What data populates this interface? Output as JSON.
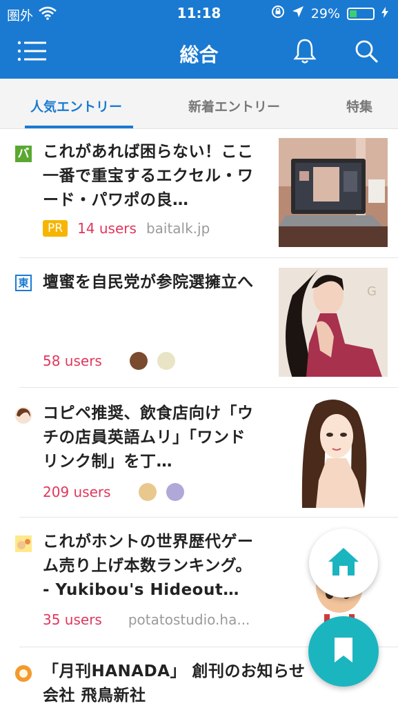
{
  "status_bar": {
    "carrier": "圏外",
    "time": "11:18",
    "battery": "29%"
  },
  "header": {
    "title": "総合"
  },
  "tabs": [
    {
      "label": "人気エントリー",
      "active": true
    },
    {
      "label": "新着エントリー",
      "active": false
    },
    {
      "label": "特集",
      "active": false
    }
  ],
  "entries": [
    {
      "favicon_text": "バ",
      "title": "これがあれば困らない！ここ一番で重宝するエクセル・ワード・パワポの良…",
      "pr": "PR",
      "users": "14 users",
      "domain": "baitalk.jp"
    },
    {
      "favicon_text": "東",
      "title": "壇蜜を自民党が参院選擁立へ",
      "users": "58 users"
    },
    {
      "title": "コピペ推奨、飲食店向け「ウチの店員英語ムリ」「ワンドリンク制」を丁…",
      "users": "209 users"
    },
    {
      "title": "これがホントの世界歴代ゲーム売り上げ本数ランキング。 - Yukibou's Hideout…",
      "users": "35 users",
      "domain": "potatostudio.ha..."
    },
    {
      "title": "「月刊HANADA」 創刊のお知らせ 会社 飛鳥新社"
    }
  ],
  "colors": {
    "brand_blue": "#1a7ad1",
    "users_red": "#e0365b",
    "pr_yellow": "#f6b500",
    "fab_teal": "#1bb5c0"
  },
  "icons": [
    "wifi-icon",
    "menu-icon",
    "bell-icon",
    "search-icon",
    "home-icon",
    "bookmark-icon"
  ]
}
